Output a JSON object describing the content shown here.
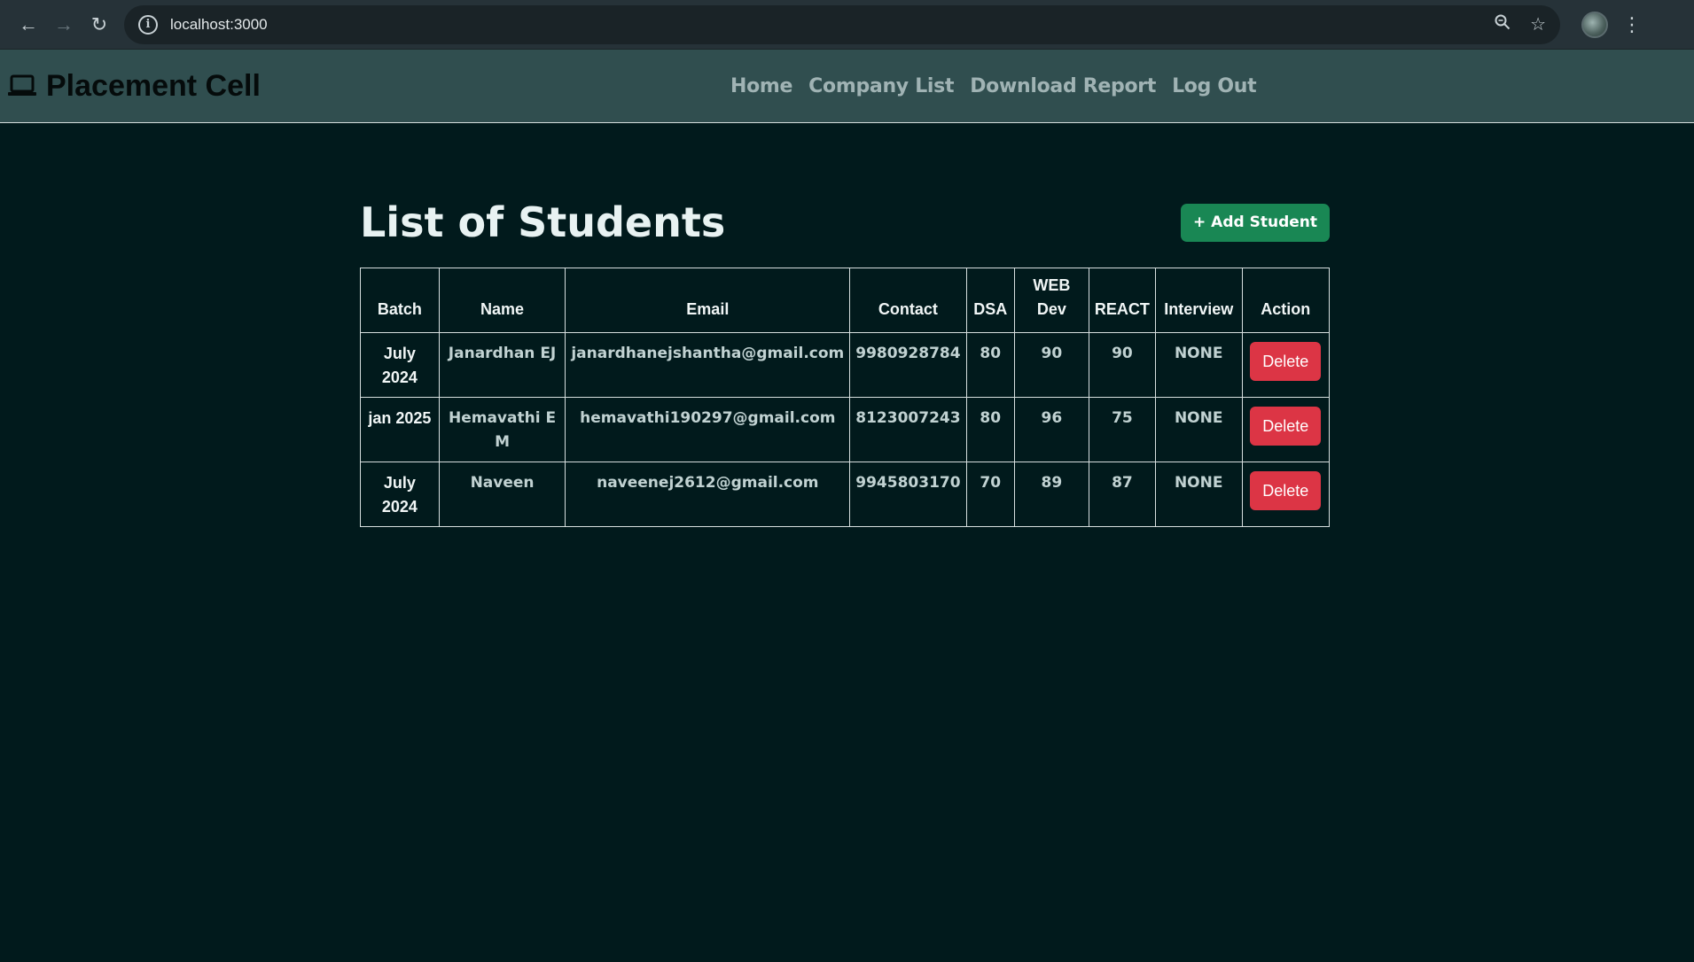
{
  "browser": {
    "url": "localhost:3000"
  },
  "navbar": {
    "brand": "Placement Cell",
    "links": [
      "Home",
      "Company List",
      "Download Report",
      "Log Out"
    ]
  },
  "main": {
    "title": "List of Students",
    "add_button_label": "+ Add Student",
    "columns": [
      "Batch",
      "Name",
      "Email",
      "Contact",
      "DSA",
      "WEB Dev",
      "REACT",
      "Interview",
      "Action"
    ],
    "rows": [
      {
        "batch": "July 2024",
        "name": "Janardhan EJ",
        "email": "janardhanejshantha@gmail.com",
        "contact": "9980928784",
        "dsa": "80",
        "web": "90",
        "react": "90",
        "interview": "NONE",
        "action": "Delete"
      },
      {
        "batch": "jan 2025",
        "name": "Hemavathi E M",
        "email": "hemavathi190297@gmail.com",
        "contact": "8123007243",
        "dsa": "80",
        "web": "96",
        "react": "75",
        "interview": "NONE",
        "action": "Delete"
      },
      {
        "batch": "July 2024",
        "name": "Naveen",
        "email": "naveenej2612@gmail.com",
        "contact": "9945803170",
        "dsa": "70",
        "web": "89",
        "react": "87",
        "interview": "NONE",
        "action": "Delete"
      }
    ]
  },
  "colors": {
    "page_bg": "#011a1c",
    "navbar_bg": "#304e4f",
    "add_button": "#198754",
    "delete_button": "#dc3545"
  }
}
